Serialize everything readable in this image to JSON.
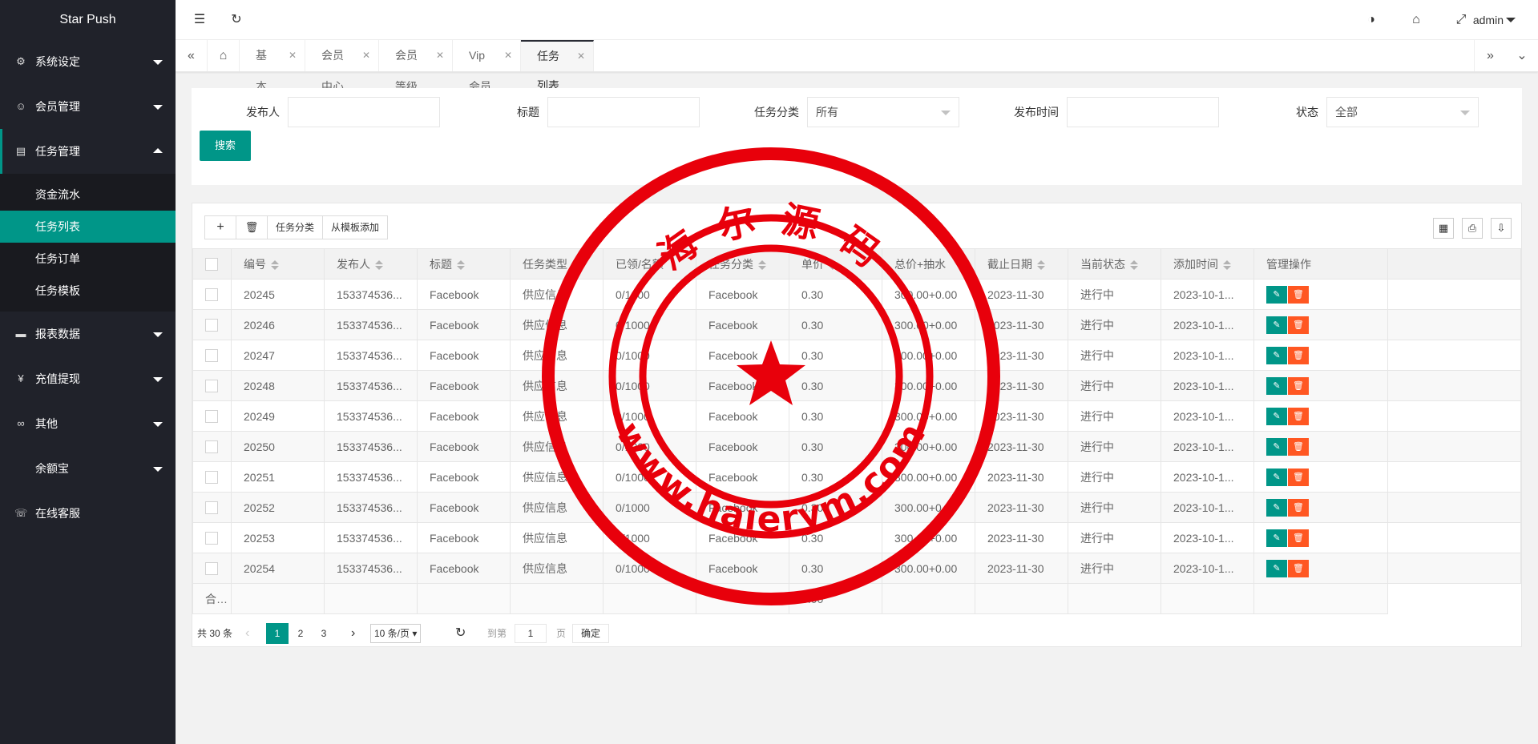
{
  "app": {
    "title": "Star Push"
  },
  "sidebar": {
    "items": [
      {
        "label": "系统设定",
        "icon": "gear-icon"
      },
      {
        "label": "会员管理",
        "icon": "user-icon"
      },
      {
        "label": "任务管理",
        "icon": "file-icon",
        "open": true,
        "children": [
          "资金流水",
          "任务列表",
          "任务订单",
          "任务模板"
        ]
      },
      {
        "label": "报表数据",
        "icon": "report-icon"
      },
      {
        "label": "充值提现",
        "icon": "yen-icon"
      },
      {
        "label": "其他",
        "icon": "link-icon"
      },
      {
        "label": "余额宝",
        "icon": ""
      },
      {
        "label": "在线客服",
        "icon": "support-icon"
      }
    ],
    "active_child": "任务列表"
  },
  "header": {
    "user": "admin"
  },
  "tabs": [
    "基本设置",
    "会员中心",
    "会员等级",
    "Vip会员",
    "任务列表"
  ],
  "active_tab": "任务列表",
  "search": {
    "fields": {
      "publisher": "发布人",
      "title": "标题",
      "category": "任务分类",
      "publish_time": "发布时间",
      "status": "状态"
    },
    "category_value": "所有",
    "status_value": "全部",
    "button": "搜索"
  },
  "toolbar": {
    "category_btn": "任务分类",
    "template_btn": "从模板添加"
  },
  "table": {
    "columns": [
      "编号",
      "发布人",
      "标题",
      "任务类型",
      "已领/名额",
      "任务分类",
      "单价",
      "总价+抽水",
      "截止日期",
      "当前状态",
      "添加时间",
      "管理操作"
    ],
    "rows": [
      [
        "20245",
        "153374536...",
        "Facebook",
        "供应信息",
        "0/1000",
        "Facebook",
        "0.30",
        "300.00+0.00",
        "2023-11-30",
        "进行中",
        "2023-10-1..."
      ],
      [
        "20246",
        "153374536...",
        "Facebook",
        "供应信息",
        "0/1000",
        "Facebook",
        "0.30",
        "300.00+0.00",
        "2023-11-30",
        "进行中",
        "2023-10-1..."
      ],
      [
        "20247",
        "153374536...",
        "Facebook",
        "供应信息",
        "0/1000",
        "Facebook",
        "0.30",
        "300.00+0.00",
        "2023-11-30",
        "进行中",
        "2023-10-1..."
      ],
      [
        "20248",
        "153374536...",
        "Facebook",
        "供应信息",
        "0/1000",
        "Facebook",
        "0.30",
        "300.00+0.00",
        "2023-11-30",
        "进行中",
        "2023-10-1..."
      ],
      [
        "20249",
        "153374536...",
        "Facebook",
        "供应信息",
        "0/1000",
        "Facebook",
        "0.30",
        "300.00+0.00",
        "2023-11-30",
        "进行中",
        "2023-10-1..."
      ],
      [
        "20250",
        "153374536...",
        "Facebook",
        "供应信息",
        "0/1000",
        "Facebook",
        "0.30",
        "300.00+0.00",
        "2023-11-30",
        "进行中",
        "2023-10-1..."
      ],
      [
        "20251",
        "153374536...",
        "Facebook",
        "供应信息",
        "0/1000",
        "Facebook",
        "0.30",
        "300.00+0.00",
        "2023-11-30",
        "进行中",
        "2023-10-1..."
      ],
      [
        "20252",
        "153374536...",
        "Facebook",
        "供应信息",
        "0/1000",
        "Facebook",
        "0.30",
        "300.00+0.00",
        "2023-11-30",
        "进行中",
        "2023-10-1..."
      ],
      [
        "20253",
        "153374536...",
        "Facebook",
        "供应信息",
        "0/1000",
        "Facebook",
        "0.30",
        "300.00+0.00",
        "2023-11-30",
        "进行中",
        "2023-10-1..."
      ],
      [
        "20254",
        "153374536...",
        "Facebook",
        "供应信息",
        "0/1000",
        "Facebook",
        "0.30",
        "300.00+0.00",
        "2023-11-30",
        "进行中",
        "2023-10-1..."
      ]
    ],
    "total_label": "合计",
    "total_price": "3.00"
  },
  "pager": {
    "total": "共 30 条",
    "pages": [
      "1",
      "2",
      "3"
    ],
    "current": "1",
    "per_page": "10 条/页",
    "goto_label": "到第",
    "goto_value": "1",
    "page_unit": "页",
    "confirm": "确定"
  },
  "watermark": {
    "text_top": "海 尔 源 码",
    "text_bottom": "www.haierym.com",
    "color": "#e8000b"
  },
  "colors": {
    "accent": "#009688",
    "danger": "#ff5722",
    "sidebar": "#20222a"
  }
}
